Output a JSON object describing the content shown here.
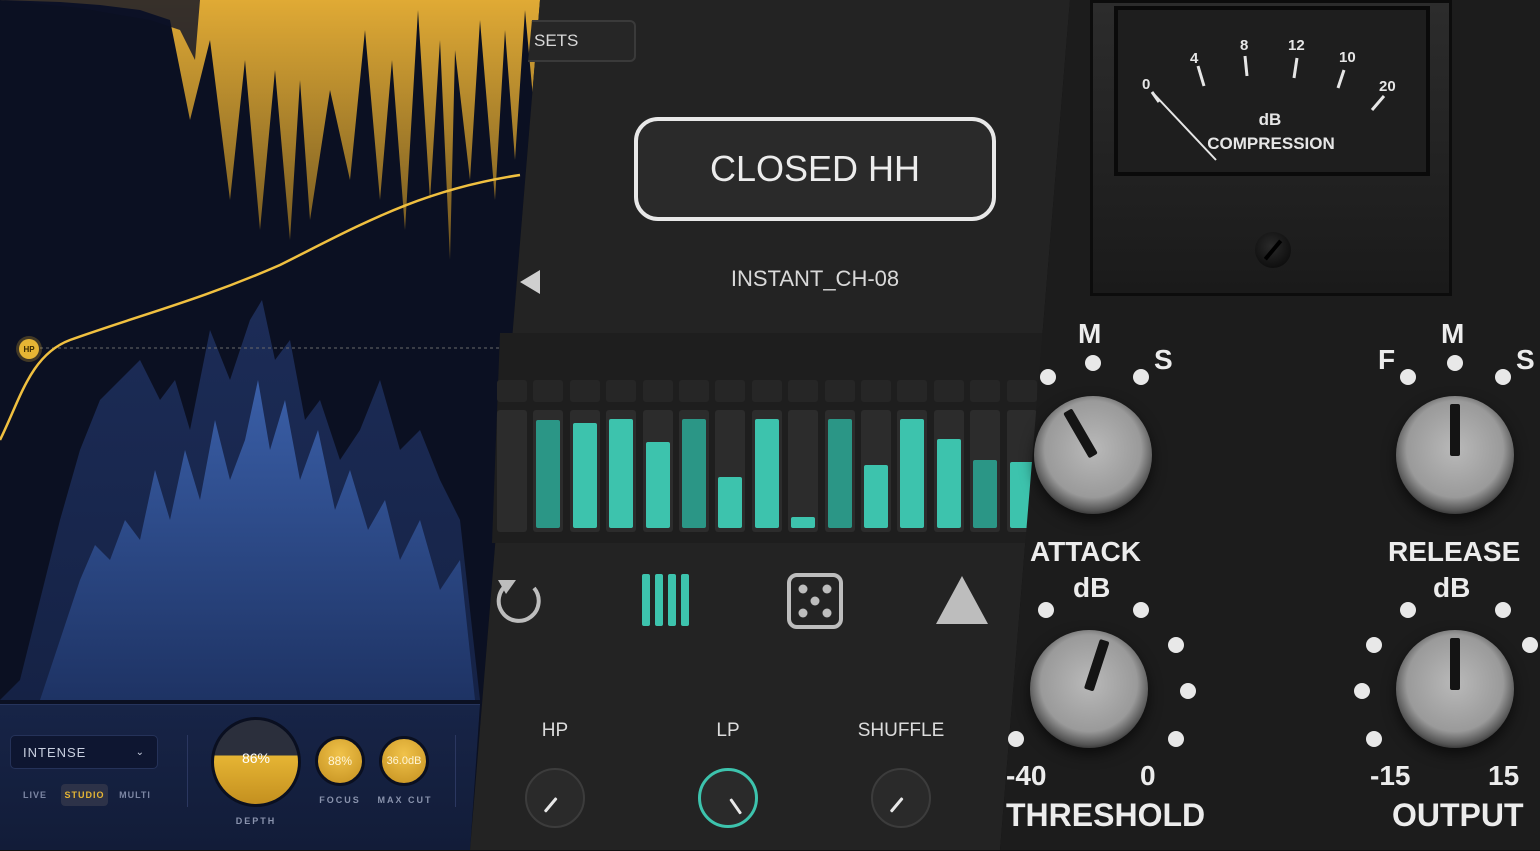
{
  "left_panel": {
    "hp_badge": "HP",
    "mode_select": {
      "value": "INTENSE"
    },
    "modes": [
      "LIVE",
      "STUDIO",
      "MULTI"
    ],
    "active_mode": "STUDIO",
    "depth": {
      "value": "86%",
      "label": "DEPTH"
    },
    "focus": {
      "value": "88%",
      "label": "FOCUS"
    },
    "max_cut": {
      "value": "36.0dB",
      "label": "MAX CUT"
    },
    "colors": {
      "accent": "#e6b534",
      "spectrum_blue": "#2f4f8a",
      "background": "#0b1022"
    }
  },
  "middle_panel": {
    "presets_button": "SETS",
    "instrument": "CLOSED HH",
    "sample": "INSTANT_CH-08",
    "step_levels": [
      0,
      0.95,
      0.92,
      0.96,
      0.75,
      0.96,
      0.45,
      0.96,
      0.1,
      0.96,
      0.55,
      0.96,
      0.78,
      0.6,
      0.58
    ],
    "dim_steps": [
      1,
      5,
      9,
      13
    ],
    "tools": [
      "reset-icon",
      "bars-icon",
      "dice-icon",
      "triangle-icon"
    ],
    "params": [
      {
        "label": "HP",
        "active": false
      },
      {
        "label": "LP",
        "active": true
      },
      {
        "label": "SHUFFLE",
        "active": false
      }
    ],
    "colors": {
      "accent": "#3dc3ad"
    }
  },
  "right_panel": {
    "meter": {
      "scale": [
        "0",
        "4",
        "8",
        "12",
        "10",
        "20"
      ],
      "unit": "dB",
      "label": "COMPRESSION"
    },
    "attack": {
      "label": "ATTACK",
      "marks": [
        "M",
        "S"
      ]
    },
    "release": {
      "label": "RELEASE",
      "marks": [
        "F",
        "M",
        "S"
      ]
    },
    "threshold": {
      "unit": "dB",
      "min": "-40",
      "max": "0",
      "label": "THRESHOLD"
    },
    "output": {
      "unit": "dB",
      "min": "-15",
      "max": "15",
      "label": "OUTPUT"
    }
  }
}
